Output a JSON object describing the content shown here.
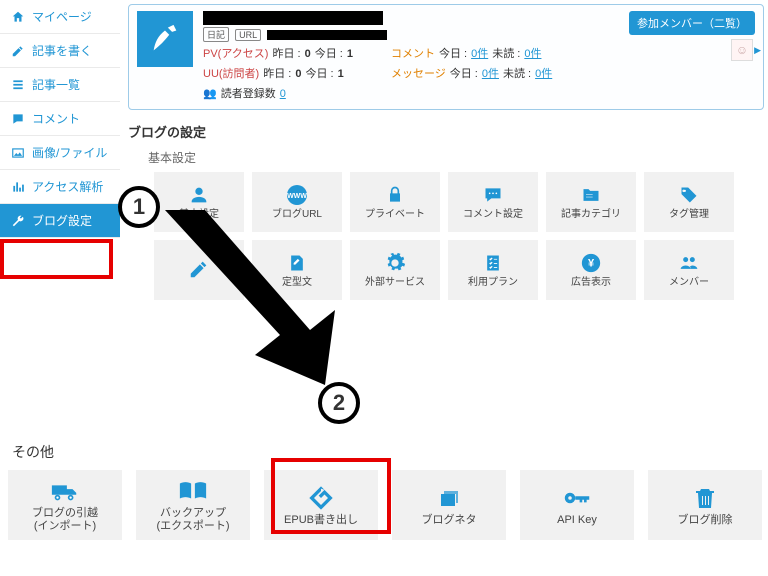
{
  "sidebar": {
    "items": [
      {
        "label": "マイページ"
      },
      {
        "label": "記事を書く"
      },
      {
        "label": "記事一覧"
      },
      {
        "label": "コメント"
      },
      {
        "label": "画像/ファイル"
      },
      {
        "label": "アクセス解析"
      },
      {
        "label": "ブログ設定"
      }
    ]
  },
  "info": {
    "tag_diary": "日記",
    "tag_url": "URL",
    "member_btn": "参加メンバー（二覧）",
    "pv_label": "PV(アクセス)",
    "uu_label": "UU(訪問者)",
    "yesterday": "昨日 :",
    "today": "今日 :",
    "pv_y": "0",
    "pv_t": "1",
    "uu_y": "0",
    "uu_t": "1",
    "comment_label": "コメント",
    "message_label": "メッセージ",
    "unread": "未読 :",
    "zero_link": "0件",
    "reader_label": "読者登録数",
    "reader_count": "0"
  },
  "sections": {
    "blog_settings_title": "ブログの設定",
    "basic_title": "基本設定",
    "other_title": "その他"
  },
  "tiles_row1": [
    {
      "label": "基本設定"
    },
    {
      "label": "ブログURL"
    },
    {
      "label": "プライベート"
    },
    {
      "label": "コメント設定"
    },
    {
      "label": "記事カテゴリ"
    },
    {
      "label": "タグ管理"
    }
  ],
  "tiles_row2": [
    {
      "label": ""
    },
    {
      "label": "定型文"
    },
    {
      "label": "外部サービス"
    },
    {
      "label": "利用プラン"
    },
    {
      "label": "広告表示"
    },
    {
      "label": "メンバー"
    }
  ],
  "tiles_other": [
    {
      "label": "ブログの引越\n(インポート)"
    },
    {
      "label": "バックアップ\n(エクスポート)"
    },
    {
      "label": "EPUB書き出し"
    },
    {
      "label": "ブログネタ"
    },
    {
      "label": "API Key"
    },
    {
      "label": "ブログ削除"
    }
  ],
  "annotations": {
    "one": "1",
    "two": "2"
  }
}
